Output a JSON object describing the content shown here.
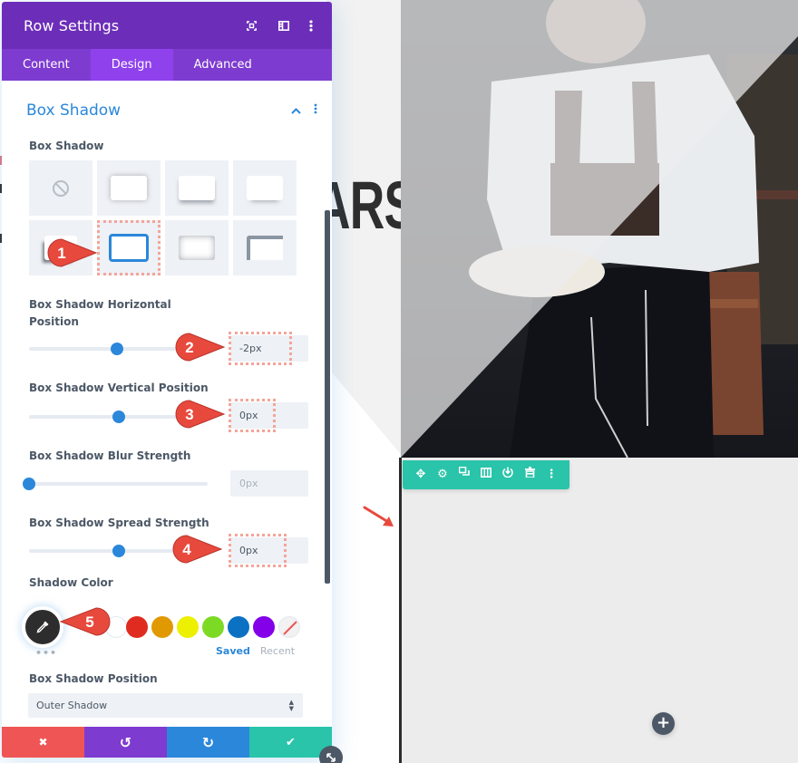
{
  "page": {
    "hero_text": "ARS",
    "row_toolbar": {
      "background": "#29c4a9",
      "icons": [
        {
          "name": "move-icon",
          "glyph": "✥"
        },
        {
          "name": "gear-icon",
          "glyph": "⚙"
        },
        {
          "name": "duplicate-icon",
          "glyph": "⧉"
        },
        {
          "name": "columns-icon",
          "glyph": "▥"
        },
        {
          "name": "save-to-library-icon",
          "glyph": "⏻"
        },
        {
          "name": "trash-icon",
          "glyph": "🗑"
        },
        {
          "name": "more-vertical-icon",
          "glyph": "⋮"
        }
      ]
    },
    "add_module_glyph": "+"
  },
  "modal": {
    "title": "Row Settings",
    "header_icons": [
      "fullscreen-icon",
      "split-view-icon",
      "more-vertical-icon"
    ],
    "tabs": [
      {
        "label": "Content",
        "active": false
      },
      {
        "label": "Design",
        "active": true
      },
      {
        "label": "Advanced",
        "active": false
      }
    ],
    "section": {
      "title": "Box Shadow",
      "expanded": true
    },
    "box_shadow": {
      "label": "Box Shadow",
      "presets": [
        "none",
        "all-around",
        "bottom-soft",
        "bottom-narrow",
        "offset-bottom-left",
        "solid-border",
        "inset",
        "corner-top-left"
      ],
      "selected_index": 5
    },
    "horizontal": {
      "label_line1": "Box Shadow Horizontal",
      "label_line2": "Position",
      "value": "-2px",
      "slider_fraction": 0.49
    },
    "vertical": {
      "label": "Box Shadow Vertical Position",
      "value": "0px",
      "slider_fraction": 0.5
    },
    "blur": {
      "label": "Box Shadow Blur Strength",
      "value": "0px",
      "slider_fraction": 0.0
    },
    "spread": {
      "label": "Box Shadow Spread Strength",
      "value": "0px",
      "slider_fraction": 0.5
    },
    "shadow_color": {
      "label": "Shadow Color",
      "current": "#2d2d2d",
      "swatches": [
        "#ffffff",
        "#e02b20",
        "#e09900",
        "#edf000",
        "#7cda24",
        "#0c71c3",
        "#8300e9"
      ],
      "more_glyph": "•••",
      "saved_label": "Saved",
      "recent_label": "Recent"
    },
    "position": {
      "label": "Box Shadow Position",
      "value": "Outer Shadow"
    },
    "footer": [
      {
        "name": "discard-button",
        "icon": "close-icon",
        "glyph": "✖",
        "color": "#ef5555"
      },
      {
        "name": "undo-button",
        "icon": "undo-icon",
        "glyph": "↺",
        "color": "#7e3bd0"
      },
      {
        "name": "redo-button",
        "icon": "redo-icon",
        "glyph": "↻",
        "color": "#2b87da"
      },
      {
        "name": "save-button",
        "icon": "check-icon",
        "glyph": "✔",
        "color": "#29c4a9"
      }
    ]
  },
  "annotations": [
    "1",
    "2",
    "3",
    "4",
    "5"
  ],
  "colors": {
    "header": "#6c2eb9",
    "tabs": "#7e3bd0",
    "tab_active": "#8f42ec",
    "accent": "#2b87da",
    "annotation": "#e8493d"
  }
}
